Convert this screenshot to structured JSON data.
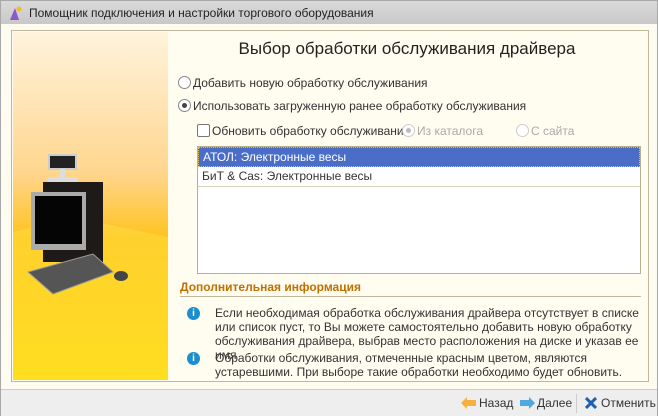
{
  "window": {
    "title": "Помощник подключения и настройки торгового оборудования"
  },
  "heading": "Выбор обработки обслуживания драйвера",
  "options": {
    "add_new": "Добавить новую обработку обслуживания",
    "use_loaded": "Использовать загруженную ранее обработку обслуживания",
    "selected": "use_loaded"
  },
  "update": {
    "label": "Обновить обработку обслуживания",
    "checked": false,
    "from_catalog": "Из каталога",
    "from_site": "С сайта"
  },
  "list": {
    "items": [
      "АТОЛ: Электронные весы",
      "БиТ & Cas: Электронные весы"
    ],
    "selected_index": 0
  },
  "info": {
    "title": "Дополнительная информация",
    "items": [
      "Если необходимая обработка обслуживания драйвера отсутствует в списке или список пуст, то Вы можете самостоятельно добавить новую обработку обслуживания драйвера, выбрав место расположения на диске и указав ее имя",
      "Обработки обслуживания, отмеченные красным цветом, являются устаревшими. При выборе такие обработки необходимо будет обновить."
    ]
  },
  "footer": {
    "back": "Назад",
    "next": "Далее",
    "cancel": "Отменить"
  }
}
